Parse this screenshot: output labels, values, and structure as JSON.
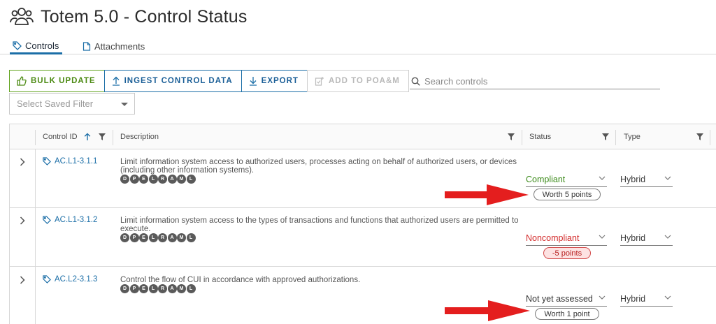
{
  "header": {
    "title": "Totem 5.0 - Control Status",
    "logo_icon": "users-group-icon"
  },
  "tabs": [
    {
      "label": "Controls",
      "icon": "tag-icon",
      "active": true
    },
    {
      "label": "Attachments",
      "icon": "document-icon",
      "active": false
    }
  ],
  "toolbar": {
    "bulk_update": "BULK UPDATE",
    "ingest": "INGEST CONTROL DATA",
    "export": "EXPORT",
    "add_poam": "ADD TO POA&M"
  },
  "search": {
    "placeholder": "Search controls"
  },
  "filter": {
    "placeholder": "Select Saved Filter"
  },
  "grid": {
    "columns": {
      "control_id": "Control ID",
      "description": "Description",
      "status": "Status",
      "type": "Type"
    },
    "rows": [
      {
        "control_id": "AC.L1-3.1.1",
        "description": "Limit information system access to authorized users, processes acting on behalf of authorized users, or devices (including other information systems).",
        "status": "Compliant",
        "points": "Worth 5 points",
        "type": "Hybrid"
      },
      {
        "control_id": "AC.L1-3.1.2",
        "description": "Limit information system access to the types of transactions and functions that authorized users are permitted to execute.",
        "status": "Noncompliant",
        "points": "-5 points",
        "type": "Hybrid"
      },
      {
        "control_id": "AC.L2-3.1.3",
        "description": "Control the flow of CUI in accordance with approved authorizations.",
        "status": "Not yet assessed",
        "points": "Worth 1 point",
        "type": "Hybrid"
      }
    ]
  },
  "badges": [
    "D",
    "P",
    "E",
    "L",
    "R",
    "A",
    "M",
    "L"
  ],
  "colors": {
    "accent": "#1b6ea7",
    "bulk": "#4c8a13",
    "compliant": "#3c8a1a",
    "noncompliant": "#d32b2b",
    "arrow": "#e41e1e"
  }
}
